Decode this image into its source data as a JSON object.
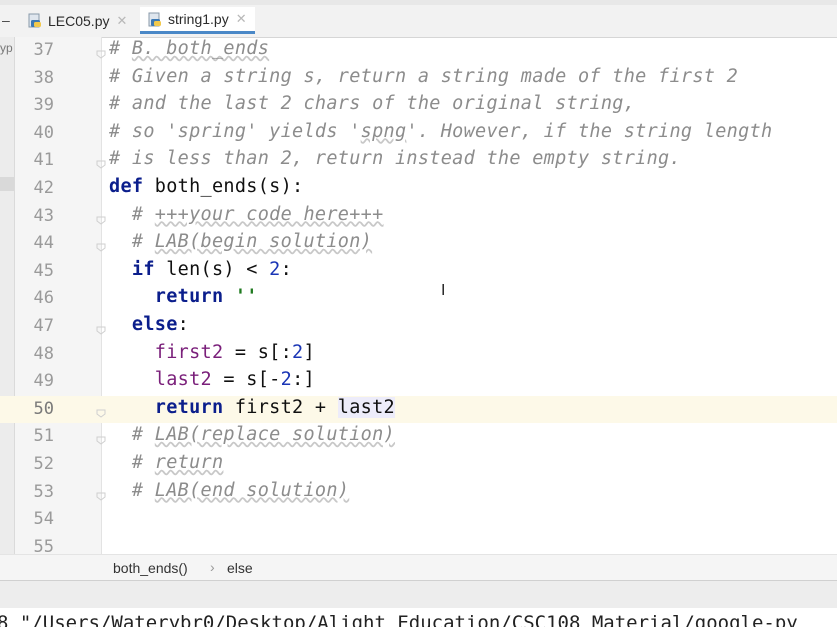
{
  "tabs": [
    {
      "label": "LEC05.py",
      "active": false
    },
    {
      "label": "string1.py",
      "active": true
    }
  ],
  "left_strip_text": "yp",
  "lines": [
    {
      "num": "37",
      "html": "<span class='cm'># <span class='uw'>B. both_ends</span></span>"
    },
    {
      "num": "38",
      "html": "<span class='cm'># Given a string s, return a string made of the first 2</span>"
    },
    {
      "num": "39",
      "html": "<span class='cm'># and the last 2 chars of the original string,</span>"
    },
    {
      "num": "40",
      "html": "<span class='cm'># so 'spring' yields '<span class='uw'>spng</span>'. However, if the string length</span>"
    },
    {
      "num": "41",
      "html": "<span class='cm'># is less than 2, return instead the empty string.</span>"
    },
    {
      "num": "42",
      "html": "<span class='kw'>def</span> both_ends(s):"
    },
    {
      "num": "43",
      "html": "  <span class='cm'># <span class='uw'>+++your code here+++</span></span>"
    },
    {
      "num": "44",
      "html": "  <span class='cm'># <span class='uw'>LAB(begin solution)</span></span>"
    },
    {
      "num": "45",
      "html": "  <span class='kw'>if</span> len(s) &lt; <span class='num-lit'>2</span>:"
    },
    {
      "num": "46",
      "html": "    <span class='kw'>return</span> <span class='str'>''</span>"
    },
    {
      "num": "47",
      "html": "  <span class='kw'>else</span>:"
    },
    {
      "num": "48",
      "html": "    <span class='var'>first2</span> = s[:<span class='num-lit'>2</span>]"
    },
    {
      "num": "49",
      "html": "    <span class='var'>last2</span> = s[-<span class='num-lit'>2</span>:]"
    },
    {
      "num": "50",
      "html": "    <span class='kw'>return</span> first2 + <span class='hl'>last2</span>",
      "current": true
    },
    {
      "num": "51",
      "html": "  <span class='cm'># <span class='uw'>LAB(replace solution)</span></span>"
    },
    {
      "num": "52",
      "html": "  <span class='cm'># <span class='uw'>return</span></span>"
    },
    {
      "num": "53",
      "html": "  <span class='cm'># <span class='uw'>LAB(end solution)</span></span>"
    },
    {
      "num": "54",
      "html": ""
    },
    {
      "num": "55",
      "html": ""
    }
  ],
  "breadcrumb": {
    "function": "both_ends()",
    "separator": "›",
    "block": "else"
  },
  "console_text": "8 \"/Users/Waterybr0/Desktop/Alight Education/CSC108 Material/google-py"
}
